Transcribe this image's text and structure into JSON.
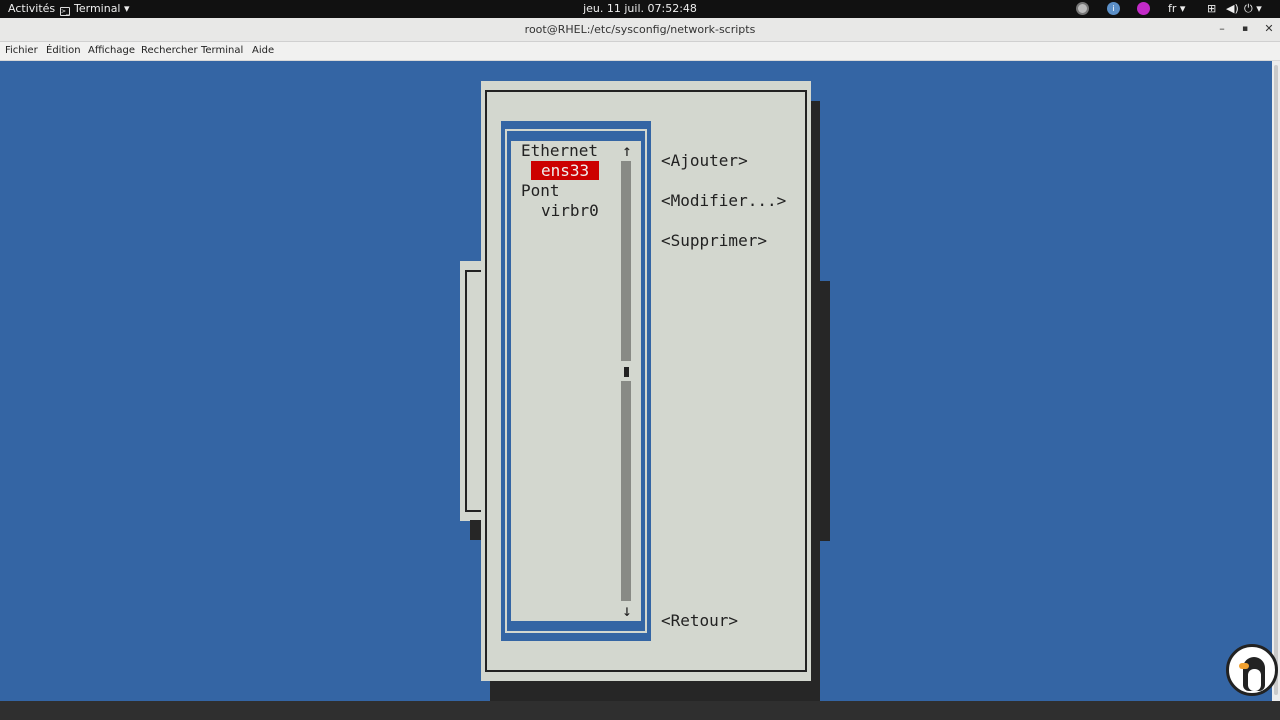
{
  "topbar": {
    "activities": "Activités",
    "app_menu": "Terminal ▾",
    "clock": "jeu. 11 juil.  07:52:48",
    "lang": "fr ▾",
    "info_icon_text": "i",
    "network_icon": "⊞",
    "volume_icon": "◀)",
    "power_icon": "⏻ ▾"
  },
  "window": {
    "title": "root@RHEL:/etc/sysconfig/network-scripts",
    "minimize": "–",
    "maximize": "▪",
    "close": "✕"
  },
  "menubar": [
    "Fichier",
    "Édition",
    "Affichage",
    "Rechercher",
    "Terminal",
    "Aide"
  ],
  "nmtui": {
    "list": [
      {
        "text": "Ethernet"
      },
      {
        "text": "ens33",
        "selected": true
      },
      {
        "text": "Pont"
      },
      {
        "text": "virbr0"
      }
    ],
    "scroll_up": "↑",
    "scroll_down": "↓",
    "buttons": {
      "add": "<Ajouter>",
      "edit": "<Modifier...>",
      "delete": "<Supprimer>",
      "back": "<Retour>"
    }
  },
  "colors": {
    "terminal_bg": "#3465a4",
    "dialog_bg": "#d3d7cf",
    "selection": "#cc0000"
  }
}
